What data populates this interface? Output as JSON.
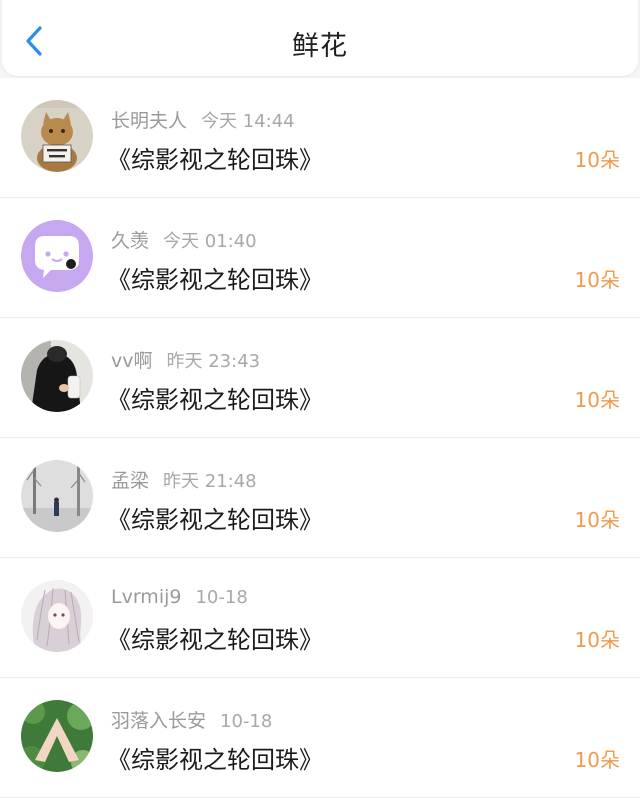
{
  "header": {
    "title": "鲜花",
    "back_icon": "chevron-left-icon",
    "accent": "#2a8df3"
  },
  "items": [
    {
      "user": "长明夫人",
      "time": "今天 14:44",
      "book": "《综影视之轮回珠》",
      "count": "10朵",
      "avatar": "cat-holding-sign"
    },
    {
      "user": "久羡",
      "time": "今天 01:40",
      "book": "《综影视之轮回珠》",
      "count": "10朵",
      "avatar": "purple-chat-bubble"
    },
    {
      "user": "vv啊",
      "time": "昨天 23:43",
      "book": "《综影视之轮回珠》",
      "count": "10朵",
      "avatar": "dark-figure"
    },
    {
      "user": "孟梁",
      "time": "昨天 21:48",
      "book": "《综影视之轮回珠》",
      "count": "10朵",
      "avatar": "misty-landscape"
    },
    {
      "user": "Lvrmij9",
      "time": "10-18",
      "book": "《综影视之轮回珠》",
      "count": "10朵",
      "avatar": "anime-girl"
    },
    {
      "user": "羽落入长安",
      "time": "10-18",
      "book": "《综影视之轮回珠》",
      "count": "10朵",
      "avatar": "hands-greenery"
    }
  ],
  "colors": {
    "count": "#f09a4b",
    "meta": "#9a9a9a"
  }
}
